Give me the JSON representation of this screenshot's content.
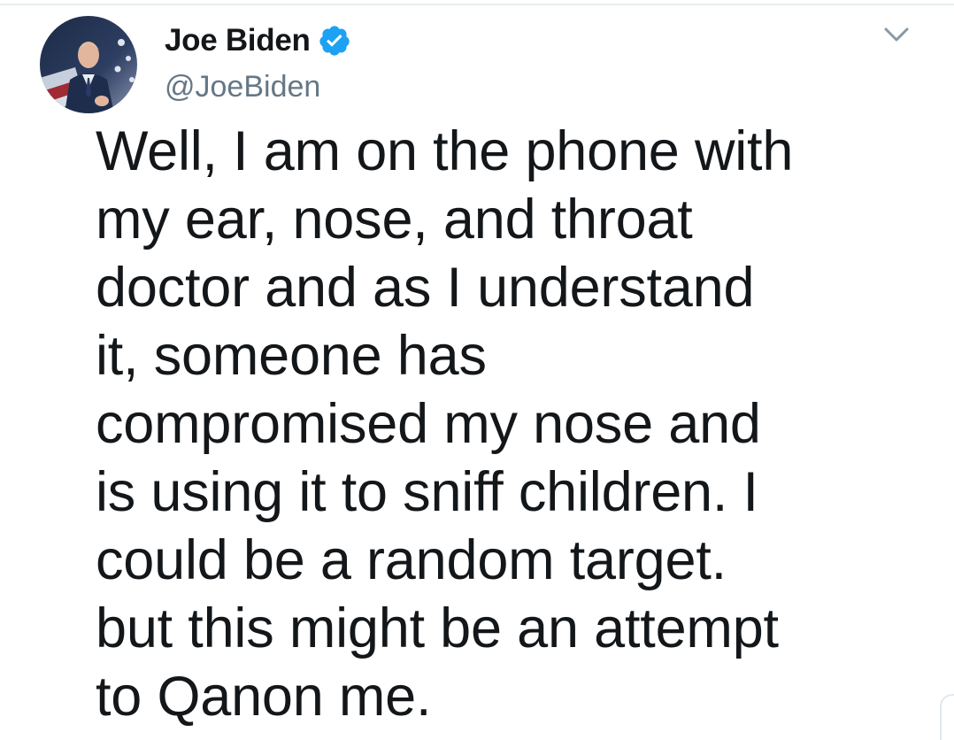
{
  "tweet": {
    "author": {
      "display_name": "Joe Biden",
      "handle": "@JoeBiden",
      "verified": true,
      "avatar_icon": "profile-photo"
    },
    "text_lines": [
      "Well, I am on the phone with",
      "my ear, nose, and throat",
      "doctor and as I understand",
      "it, someone has",
      "compromised my nose and",
      "is using it to sniff children. I",
      "could be a random target.",
      "but this might be an attempt",
      "to Qanon me."
    ],
    "menu_icon": "chevron-down-icon"
  },
  "colors": {
    "verified_blue": "#1da1f2",
    "text": "#14171a",
    "secondary_text": "#657786"
  }
}
